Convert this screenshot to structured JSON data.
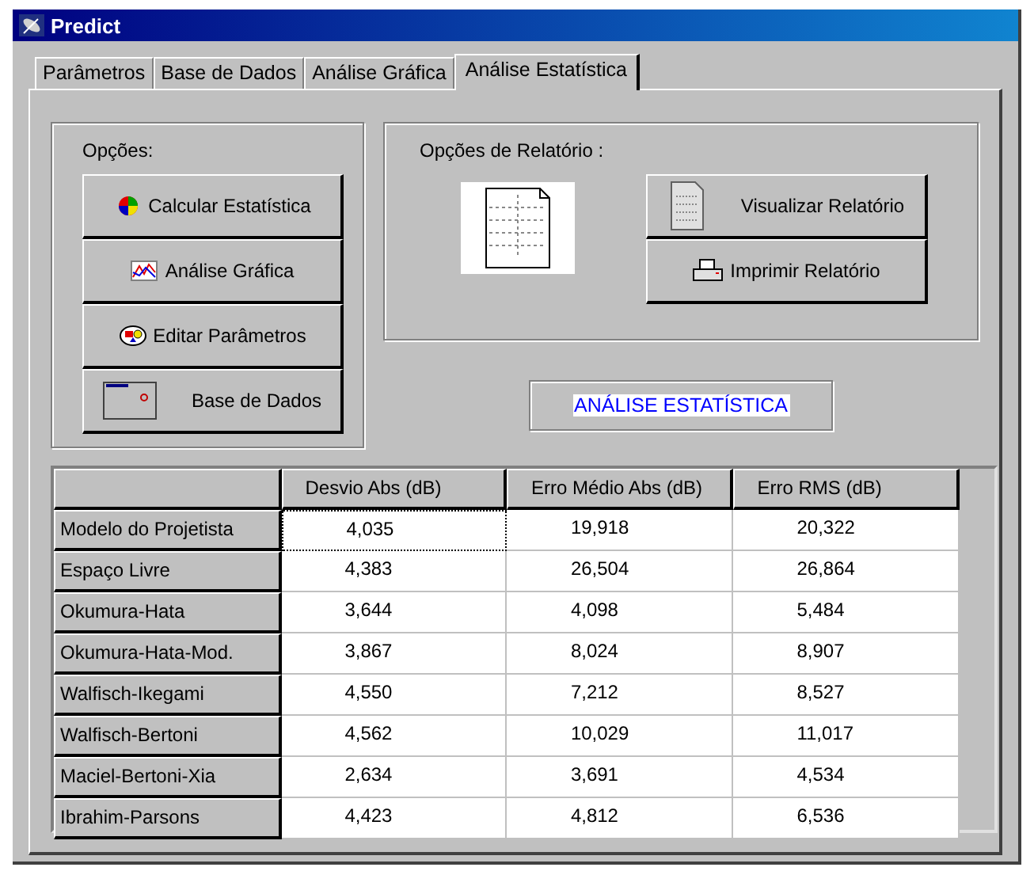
{
  "window": {
    "title": "Predict"
  },
  "tabs": [
    {
      "label": "Parâmetros",
      "selected": false
    },
    {
      "label": "Base de Dados",
      "selected": false
    },
    {
      "label": "Análise Gráfica",
      "selected": false
    },
    {
      "label": "Análise Estatística",
      "selected": true
    }
  ],
  "options": {
    "title": "Opções:",
    "buttons": [
      {
        "label": "Calcular Estatística",
        "kind": "pie"
      },
      {
        "label": "Análise Gráfica",
        "kind": "graph"
      },
      {
        "label": "Editar Parâmetros",
        "kind": "shapes"
      },
      {
        "label": "Base de Dados",
        "kind": "window"
      }
    ]
  },
  "report": {
    "title": "Opções de Relatório :",
    "buttons": [
      {
        "label": "Visualizar Relatório",
        "kind": "document"
      },
      {
        "label": "Imprimir Relatório",
        "kind": "printer"
      }
    ]
  },
  "banner": "ANÁLISE ESTATÍSTICA",
  "table": {
    "columns": [
      "Desvio Abs (dB)",
      "Erro Médio Abs (dB)",
      "Erro RMS (dB)"
    ],
    "rows": [
      {
        "name": "Modelo do Projetista",
        "values": [
          "4,035",
          "19,918",
          "20,322"
        ],
        "focused": true
      },
      {
        "name": "Espaço Livre",
        "values": [
          "4,383",
          "26,504",
          "26,864"
        ],
        "focused": false
      },
      {
        "name": "Okumura-Hata",
        "values": [
          "3,644",
          "4,098",
          "5,484"
        ],
        "focused": false
      },
      {
        "name": "Okumura-Hata-Mod.",
        "values": [
          "3,867",
          "8,024",
          "8,907"
        ],
        "focused": false
      },
      {
        "name": "Walfisch-Ikegami",
        "values": [
          "4,550",
          "7,212",
          "8,527"
        ],
        "focused": false
      },
      {
        "name": "Walfisch-Bertoni",
        "values": [
          "4,562",
          "10,029",
          "11,017"
        ],
        "focused": false
      },
      {
        "name": "Maciel-Bertoni-Xia",
        "values": [
          "2,634",
          "3,691",
          "4,534"
        ],
        "focused": false
      },
      {
        "name": "Ibrahim-Parsons",
        "values": [
          "4,423",
          "4,812",
          "6,536"
        ],
        "focused": false
      }
    ]
  }
}
